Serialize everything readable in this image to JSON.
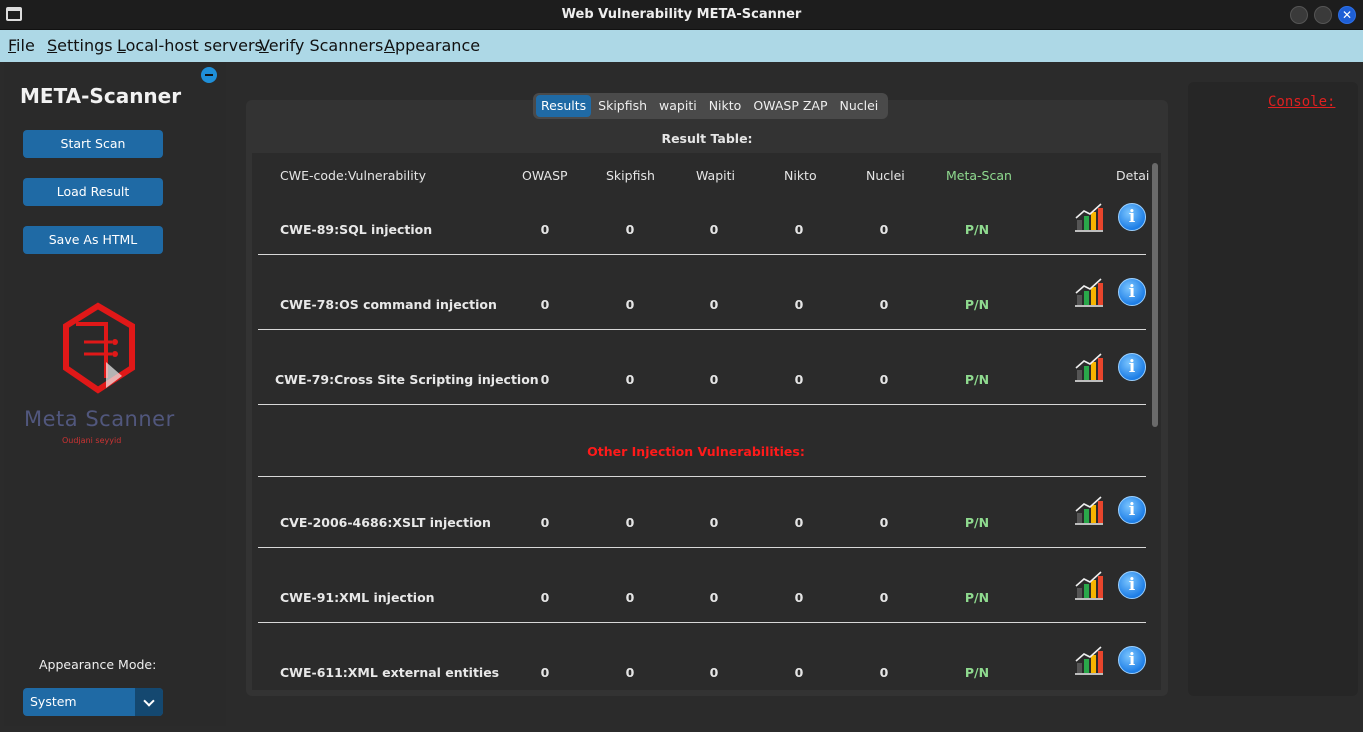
{
  "window": {
    "title": "Web Vulnerability META-Scanner"
  },
  "menu": [
    {
      "label": "File",
      "ul": "F",
      "rest": "ile"
    },
    {
      "label": "Settings",
      "ul": "S",
      "rest": "ettings"
    },
    {
      "label": "Local-host servers",
      "ul": "L",
      "rest": "ocal-host servers"
    },
    {
      "label": "Verify Scanners",
      "ul": "V",
      "rest": "erify Scanners"
    },
    {
      "label": "Appearance",
      "ul": "A",
      "rest": "ppearance"
    }
  ],
  "sidebar": {
    "title": "META-Scanner",
    "buttons": [
      "Start Scan",
      "Load Result",
      "Save As HTML"
    ],
    "logo_text": "Meta Scanner",
    "logo_sub": "Oudjani seyyid",
    "appearance_label": "Appearance Mode:",
    "appearance_value": "System"
  },
  "tabs": [
    "Results",
    "Skipfish",
    "wapiti",
    "Nikto",
    "OWASP ZAP",
    "Nuclei"
  ],
  "active_tab": "Results",
  "table": {
    "title": "Result Table:",
    "headers": [
      "CWE-code:Vulnerability",
      "OWASP",
      "Skipfish",
      "Wapiti",
      "Nikto",
      "Nuclei",
      "Meta-Scan",
      "Detai"
    ],
    "rows": [
      {
        "name": "CWE-89:SQL injection",
        "owasp": "0",
        "skipfish": "0",
        "wapiti": "0",
        "nikto": "0",
        "nuclei": "0",
        "meta": "P/N"
      },
      {
        "name": "CWE-78:OS command injection",
        "owasp": "0",
        "skipfish": "0",
        "wapiti": "0",
        "nikto": "0",
        "nuclei": "0",
        "meta": "P/N"
      },
      {
        "name": "CWE-79:Cross Site Scripting injection",
        "owasp": "0",
        "skipfish": "0",
        "wapiti": "0",
        "nikto": "0",
        "nuclei": "0",
        "meta": "P/N"
      },
      {
        "name": "CVE-2006-4686:XSLT injection",
        "owasp": "0",
        "skipfish": "0",
        "wapiti": "0",
        "nikto": "0",
        "nuclei": "0",
        "meta": "P/N"
      },
      {
        "name": "CWE-91:XML injection",
        "owasp": "0",
        "skipfish": "0",
        "wapiti": "0",
        "nikto": "0",
        "nuclei": "0",
        "meta": "P/N"
      },
      {
        "name": "CWE-611:XML external entities",
        "owasp": "0",
        "skipfish": "0",
        "wapiti": "0",
        "nikto": "0",
        "nuclei": "0",
        "meta": "P/N"
      }
    ],
    "section_label": "Other Injection Vulnerabilities:"
  },
  "console": {
    "label": "Console:"
  },
  "colors": {
    "accent": "#1f6aa5",
    "menubar": "#add8e6",
    "meta_green": "#8fda8f",
    "section_red": "#ff1a1a"
  }
}
